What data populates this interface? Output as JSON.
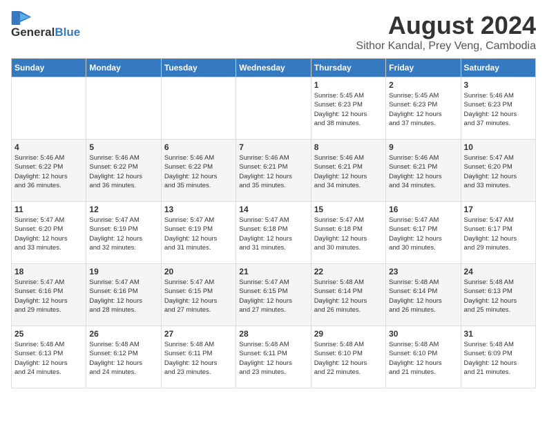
{
  "header": {
    "logo_line1": "General",
    "logo_line2": "Blue",
    "month": "August 2024",
    "location": "Sithor Kandal, Prey Veng, Cambodia"
  },
  "weekdays": [
    "Sunday",
    "Monday",
    "Tuesday",
    "Wednesday",
    "Thursday",
    "Friday",
    "Saturday"
  ],
  "weeks": [
    [
      {
        "day": "",
        "info": ""
      },
      {
        "day": "",
        "info": ""
      },
      {
        "day": "",
        "info": ""
      },
      {
        "day": "",
        "info": ""
      },
      {
        "day": "1",
        "info": "Sunrise: 5:45 AM\nSunset: 6:23 PM\nDaylight: 12 hours\nand 38 minutes."
      },
      {
        "day": "2",
        "info": "Sunrise: 5:45 AM\nSunset: 6:23 PM\nDaylight: 12 hours\nand 37 minutes."
      },
      {
        "day": "3",
        "info": "Sunrise: 5:46 AM\nSunset: 6:23 PM\nDaylight: 12 hours\nand 37 minutes."
      }
    ],
    [
      {
        "day": "4",
        "info": "Sunrise: 5:46 AM\nSunset: 6:22 PM\nDaylight: 12 hours\nand 36 minutes."
      },
      {
        "day": "5",
        "info": "Sunrise: 5:46 AM\nSunset: 6:22 PM\nDaylight: 12 hours\nand 36 minutes."
      },
      {
        "day": "6",
        "info": "Sunrise: 5:46 AM\nSunset: 6:22 PM\nDaylight: 12 hours\nand 35 minutes."
      },
      {
        "day": "7",
        "info": "Sunrise: 5:46 AM\nSunset: 6:21 PM\nDaylight: 12 hours\nand 35 minutes."
      },
      {
        "day": "8",
        "info": "Sunrise: 5:46 AM\nSunset: 6:21 PM\nDaylight: 12 hours\nand 34 minutes."
      },
      {
        "day": "9",
        "info": "Sunrise: 5:46 AM\nSunset: 6:21 PM\nDaylight: 12 hours\nand 34 minutes."
      },
      {
        "day": "10",
        "info": "Sunrise: 5:47 AM\nSunset: 6:20 PM\nDaylight: 12 hours\nand 33 minutes."
      }
    ],
    [
      {
        "day": "11",
        "info": "Sunrise: 5:47 AM\nSunset: 6:20 PM\nDaylight: 12 hours\nand 33 minutes."
      },
      {
        "day": "12",
        "info": "Sunrise: 5:47 AM\nSunset: 6:19 PM\nDaylight: 12 hours\nand 32 minutes."
      },
      {
        "day": "13",
        "info": "Sunrise: 5:47 AM\nSunset: 6:19 PM\nDaylight: 12 hours\nand 31 minutes."
      },
      {
        "day": "14",
        "info": "Sunrise: 5:47 AM\nSunset: 6:18 PM\nDaylight: 12 hours\nand 31 minutes."
      },
      {
        "day": "15",
        "info": "Sunrise: 5:47 AM\nSunset: 6:18 PM\nDaylight: 12 hours\nand 30 minutes."
      },
      {
        "day": "16",
        "info": "Sunrise: 5:47 AM\nSunset: 6:17 PM\nDaylight: 12 hours\nand 30 minutes."
      },
      {
        "day": "17",
        "info": "Sunrise: 5:47 AM\nSunset: 6:17 PM\nDaylight: 12 hours\nand 29 minutes."
      }
    ],
    [
      {
        "day": "18",
        "info": "Sunrise: 5:47 AM\nSunset: 6:16 PM\nDaylight: 12 hours\nand 29 minutes."
      },
      {
        "day": "19",
        "info": "Sunrise: 5:47 AM\nSunset: 6:16 PM\nDaylight: 12 hours\nand 28 minutes."
      },
      {
        "day": "20",
        "info": "Sunrise: 5:47 AM\nSunset: 6:15 PM\nDaylight: 12 hours\nand 27 minutes."
      },
      {
        "day": "21",
        "info": "Sunrise: 5:47 AM\nSunset: 6:15 PM\nDaylight: 12 hours\nand 27 minutes."
      },
      {
        "day": "22",
        "info": "Sunrise: 5:48 AM\nSunset: 6:14 PM\nDaylight: 12 hours\nand 26 minutes."
      },
      {
        "day": "23",
        "info": "Sunrise: 5:48 AM\nSunset: 6:14 PM\nDaylight: 12 hours\nand 26 minutes."
      },
      {
        "day": "24",
        "info": "Sunrise: 5:48 AM\nSunset: 6:13 PM\nDaylight: 12 hours\nand 25 minutes."
      }
    ],
    [
      {
        "day": "25",
        "info": "Sunrise: 5:48 AM\nSunset: 6:13 PM\nDaylight: 12 hours\nand 24 minutes."
      },
      {
        "day": "26",
        "info": "Sunrise: 5:48 AM\nSunset: 6:12 PM\nDaylight: 12 hours\nand 24 minutes."
      },
      {
        "day": "27",
        "info": "Sunrise: 5:48 AM\nSunset: 6:11 PM\nDaylight: 12 hours\nand 23 minutes."
      },
      {
        "day": "28",
        "info": "Sunrise: 5:48 AM\nSunset: 6:11 PM\nDaylight: 12 hours\nand 23 minutes."
      },
      {
        "day": "29",
        "info": "Sunrise: 5:48 AM\nSunset: 6:10 PM\nDaylight: 12 hours\nand 22 minutes."
      },
      {
        "day": "30",
        "info": "Sunrise: 5:48 AM\nSunset: 6:10 PM\nDaylight: 12 hours\nand 21 minutes."
      },
      {
        "day": "31",
        "info": "Sunrise: 5:48 AM\nSunset: 6:09 PM\nDaylight: 12 hours\nand 21 minutes."
      }
    ]
  ]
}
